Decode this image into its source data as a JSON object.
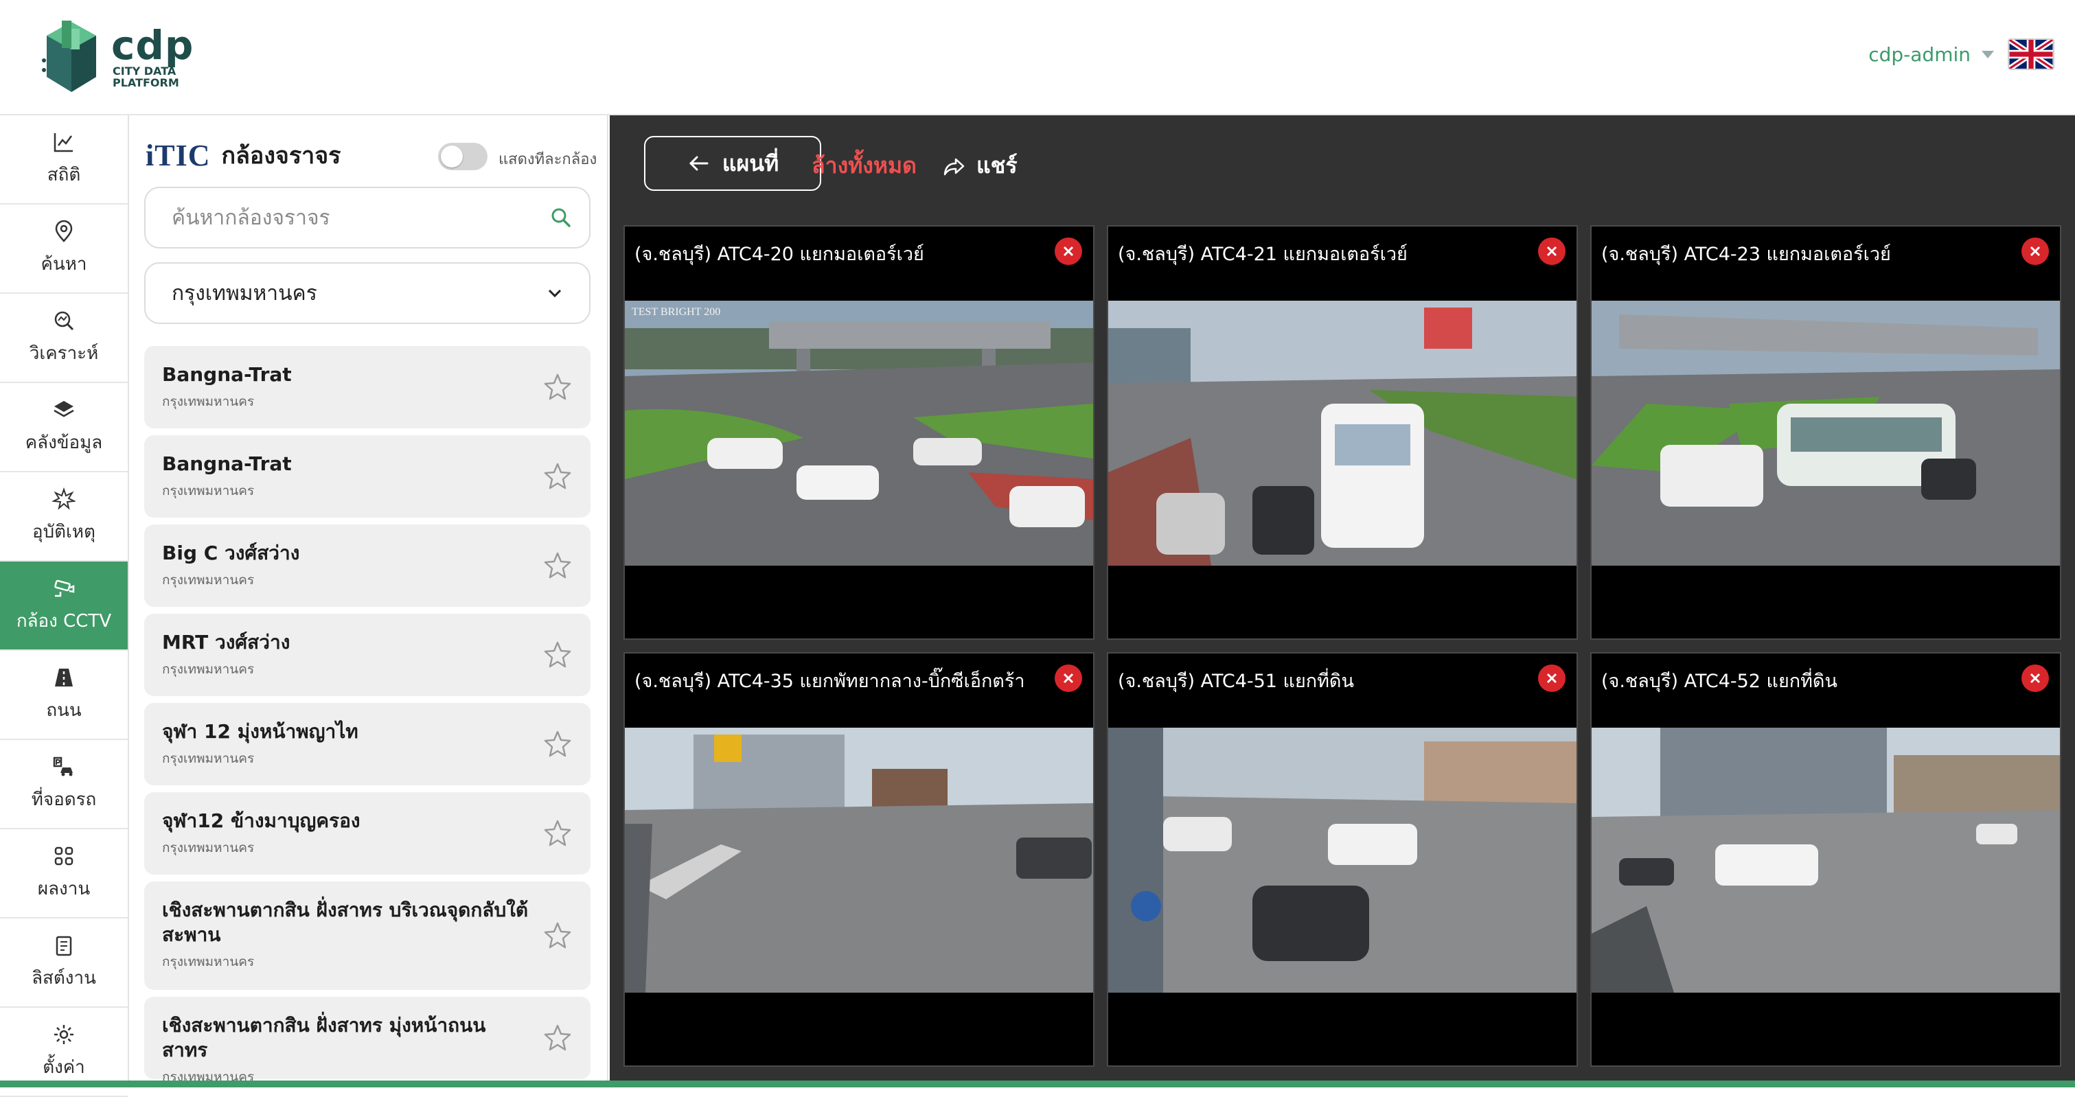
{
  "header": {
    "logo_big": "cdp",
    "logo_line1": "CITY DATA",
    "logo_line2": "PLATFORM",
    "user_name": "cdp-admin",
    "language_flag": "uk-flag-icon"
  },
  "nav": {
    "items": [
      {
        "label": "สถิติ",
        "icon": "chart-icon"
      },
      {
        "label": "ค้นหา",
        "icon": "location-pin-icon"
      },
      {
        "label": "วิเคราะห์",
        "icon": "analyze-icon"
      },
      {
        "label": "คลังข้อมูล",
        "icon": "layers-icon"
      },
      {
        "label": "อุบัติเหตุ",
        "icon": "accident-icon"
      },
      {
        "label": "กล้อง CCTV",
        "icon": "cctv-icon",
        "active": true
      },
      {
        "label": "ถนน",
        "icon": "road-icon"
      },
      {
        "label": "ที่จอดรถ",
        "icon": "parking-icon"
      },
      {
        "label": "ผลงาน",
        "icon": "grid-icon"
      },
      {
        "label": "ลิสต์งาน",
        "icon": "clipboard-icon"
      },
      {
        "label": "ตั้งค่า",
        "icon": "gear-icon"
      }
    ],
    "active_color": "#3f9b67"
  },
  "panel": {
    "brand": "iTIC",
    "title": "กล้องจราจร",
    "toggle_label": "แสดงทีละกล้อง",
    "search_placeholder": "ค้นหากล้องจราจร",
    "province_selected": "กรุงเทพมหานคร",
    "cameras": [
      {
        "name": "Bangna-Trat",
        "province": "กรุงเทพมหานคร"
      },
      {
        "name": "Bangna-Trat",
        "province": "กรุงเทพมหานคร"
      },
      {
        "name": "Big C วงศ์สว่าง",
        "province": "กรุงเทพมหานคร"
      },
      {
        "name": "MRT วงศ์สว่าง",
        "province": "กรุงเทพมหานคร"
      },
      {
        "name": "จุฬา 12 มุ่งหน้าพญาไท",
        "province": "กรุงเทพมหานคร"
      },
      {
        "name": "จุฬา12 ข้างมาบุญครอง",
        "province": "กรุงเทพมหานคร"
      },
      {
        "name": "เชิงสะพานตากสิน ฝั่งสาทร บริเวณจุดกลับใต้สะพาน",
        "province": "กรุงเทพมหานคร"
      },
      {
        "name": "เชิงสะพานตากสิน ฝั่งสาทร มุ่งหน้าถนนสาทร",
        "province": "กรุงเทพมหานคร"
      }
    ]
  },
  "toolbar": {
    "back_label": "แผนที่",
    "clear_label": "ล้างทั้งหมด",
    "share_label": "แชร์",
    "clear_color": "#ee5050"
  },
  "feeds": [
    {
      "title": "(จ.ชลบุรี) ATC4-20 แยกมอเตอร์เวย์",
      "stamp": "TEST BRIGHT 200"
    },
    {
      "title": "(จ.ชลบุรี) ATC4-21 แยกมอเตอร์เวย์"
    },
    {
      "title": "(จ.ชลบุรี) ATC4-23 แยกมอเตอร์เวย์"
    },
    {
      "title": "(จ.ชลบุรี) ATC4-35 แยกพัทยากลาง-บิ๊กซีเอ็กตร้า"
    },
    {
      "title": "(จ.ชลบุรี) ATC4-51 แยกที่ดิน"
    },
    {
      "title": "(จ.ชลบุรี) ATC4-52 แยกที่ดิน"
    }
  ]
}
